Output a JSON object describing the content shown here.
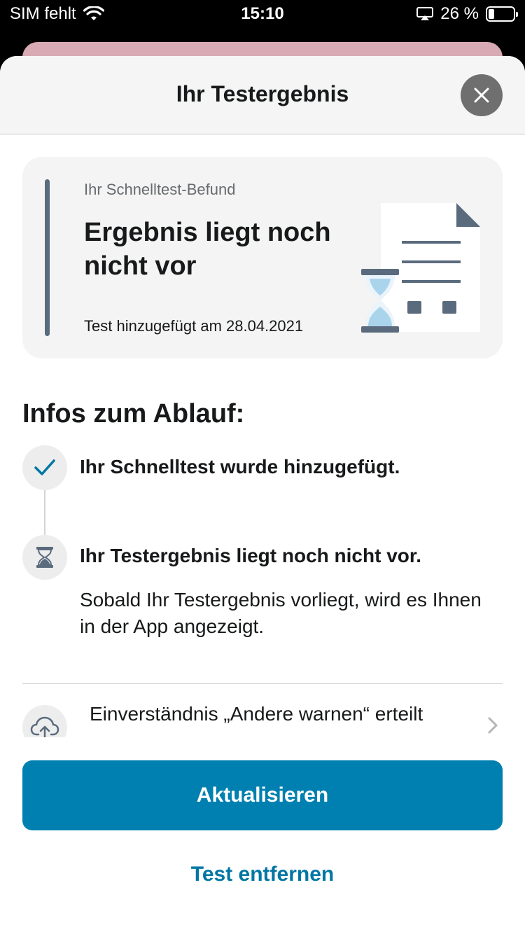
{
  "status_bar": {
    "carrier": "SIM fehlt",
    "time": "15:10",
    "battery": "26 %"
  },
  "sheet": {
    "title": "Ihr Testergebnis",
    "close_icon": "close-icon"
  },
  "result_card": {
    "label": "Ihr Schnelltest-Befund",
    "title": "Ergebnis liegt noch nicht vor",
    "date_text": "Test hinzugefügt am 28.04.2021",
    "accent_color": "#5a6b7e"
  },
  "infos": {
    "heading": "Infos zum Ablauf:",
    "steps": [
      {
        "icon": "checkmark-icon",
        "text": "Ihr Schnelltest wurde hinzugefügt."
      },
      {
        "icon": "hourglass-icon",
        "text": "Ihr Testergebnis liegt noch nicht vor.",
        "subtext": "Sobald Ihr Testergebnis vorliegt, wird es Ihnen in der App angezeigt."
      }
    ]
  },
  "consent": {
    "icon": "cloud-upload-icon",
    "text": "Einverständnis „Andere warnen“ erteilt"
  },
  "actions": {
    "primary": "Aktualisieren",
    "secondary": "Test entfernen",
    "primary_color": "#0080b0"
  }
}
